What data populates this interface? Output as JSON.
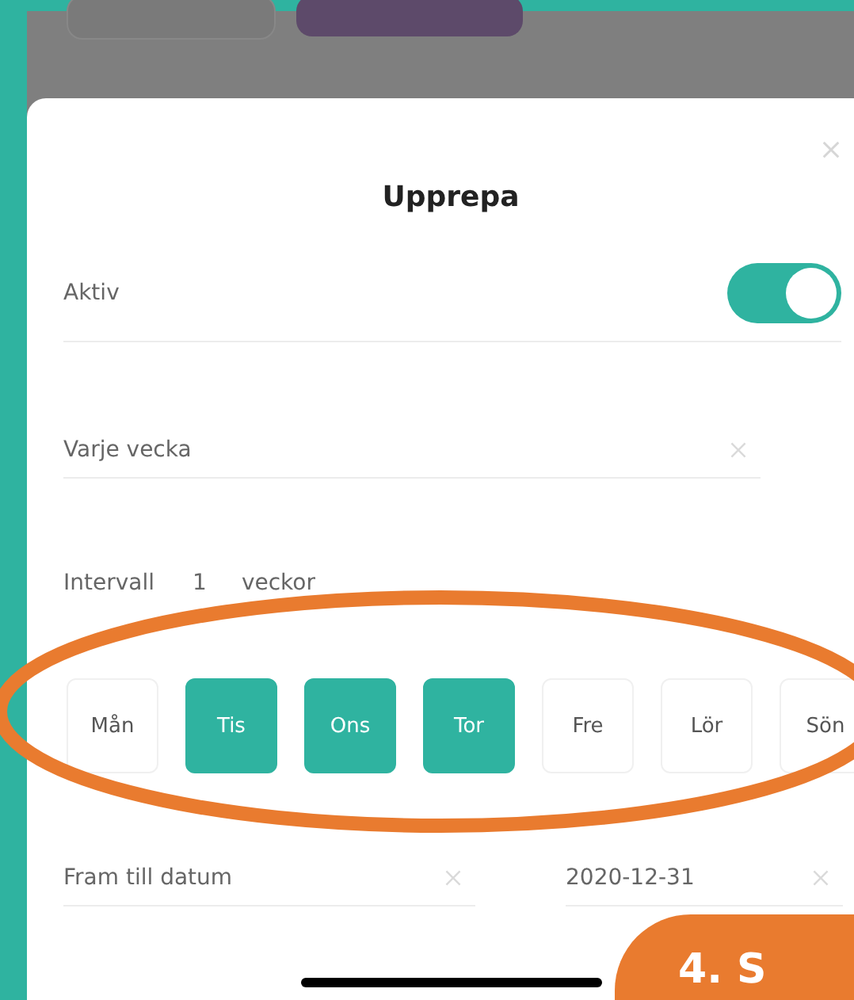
{
  "sheet": {
    "title": "Upprepa"
  },
  "active": {
    "label": "Aktiv",
    "on": true
  },
  "frequency": {
    "value": "Varje vecka"
  },
  "interval": {
    "label": "Intervall",
    "value": "1",
    "unit": "veckor"
  },
  "days": [
    {
      "label": "Mån",
      "selected": false
    },
    {
      "label": "Tis",
      "selected": true
    },
    {
      "label": "Ons",
      "selected": true
    },
    {
      "label": "Tor",
      "selected": true
    },
    {
      "label": "Fre",
      "selected": false
    },
    {
      "label": "Lör",
      "selected": false
    },
    {
      "label": "Sön",
      "selected": false
    }
  ],
  "end": {
    "label": "Fram till datum",
    "date": "2020-12-31"
  },
  "annotation": {
    "step_label": "4. S"
  }
}
